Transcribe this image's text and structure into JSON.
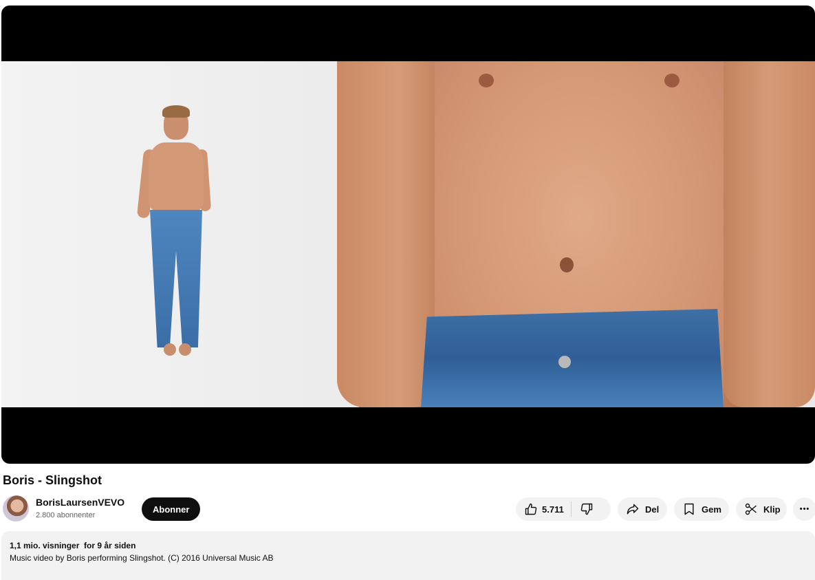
{
  "video": {
    "title": "Boris - Slingshot"
  },
  "channel": {
    "name": "BorisLaursenVEVO",
    "subscribers": "2.800 abonnenter",
    "subscribe_label": "Abonner"
  },
  "actions": {
    "like_count": "5.711",
    "share_label": "Del",
    "save_label": "Gem",
    "clip_label": "Klip",
    "more_label": "•••"
  },
  "description": {
    "views": "1,1 mio. visninger",
    "age": "for 9 år siden",
    "text": "Music video by Boris performing Slingshot. (C) 2016 Universal Music AB"
  },
  "icons": {
    "like": "thumbs-up-icon",
    "dislike": "thumbs-down-icon",
    "share": "share-arrow-icon",
    "save": "bookmark-icon",
    "clip": "scissors-icon",
    "more": "more-horizontal-icon"
  },
  "colors": {
    "subscribe_bg": "#0f0f0f",
    "pill_bg": "#f2f2f2"
  }
}
